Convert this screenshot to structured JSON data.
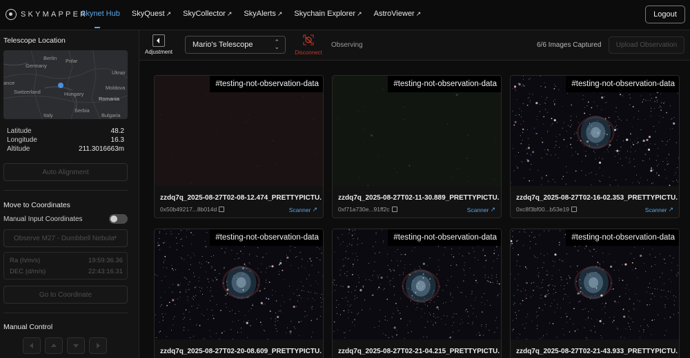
{
  "nav": {
    "logo": "SKYMAPPER",
    "links": [
      {
        "label": "Skynet Hub",
        "active": true,
        "external": false
      },
      {
        "label": "SkyQuest",
        "external": true
      },
      {
        "label": "SkyCollector",
        "external": true
      },
      {
        "label": "SkyAlerts",
        "external": true
      },
      {
        "label": "Skychain Explorer",
        "external": true
      },
      {
        "label": "AstroViewer",
        "external": true
      }
    ],
    "external_glyph": "↗",
    "logout": "Logout"
  },
  "sidebar": {
    "location_title": "Telescope Location",
    "map_labels": [
      "Berlin",
      "Germany",
      "Polar",
      "Ukrair",
      "ance",
      "Switzerland",
      "Hungary",
      "Moldova",
      "Romania",
      "Serbia",
      "Bulgaria",
      "Italy"
    ],
    "latitude_label": "Latitude",
    "latitude_value": "48.2",
    "longitude_label": "Longitude",
    "longitude_value": "16.3",
    "altitude_label": "Altitude",
    "altitude_value": "211.3016663m",
    "auto_alignment": "Auto Alignment",
    "move_title": "Move to Coordinates",
    "manual_input_label": "Manual Input Coordinates",
    "manual_input_enabled": false,
    "observe_button": "Observe M27 - Dumbbell Nebula",
    "observe_plus": "+",
    "ra_label": "Ra (h/m/s)",
    "ra_value": "19:59:36.36",
    "dec_label": "DEC (d/m/s)",
    "dec_value": "22:43:16.31",
    "goto_button": "Go to Coordinate",
    "manual_control_title": "Manual Control"
  },
  "controlbar": {
    "adjustment_label": "Adjustment",
    "telescope_select": "Mario's Telescope",
    "disconnect_label": "Disconnect",
    "status": "Observing",
    "captured": "6/6 Images Captured",
    "upload": "Upload Observation"
  },
  "colors": {
    "accent": "#5aa7e8",
    "danger": "#c0392b"
  },
  "images": [
    {
      "tag": "#testing-not-observation-data",
      "filename": "zzdq7q_2025-08-27T02-08-12.474_PRETTYPICTU...",
      "hash": "0x50b49217...8b014d",
      "scanner": "Scanner",
      "style": "dark-red",
      "nebula": false
    },
    {
      "tag": "#testing-not-observation-data",
      "filename": "zzdq7q_2025-08-27T02-11-30.889_PRETTYPICTU...",
      "hash": "0xf71a730e...91ff2c",
      "scanner": "Scanner",
      "style": "dark-green",
      "nebula": false
    },
    {
      "tag": "#testing-not-observation-data",
      "filename": "zzdq7q_2025-08-27T02-16-02.353_PRETTYPICTU...",
      "hash": "0xc8f3bf00...b53e19",
      "scanner": "Scanner",
      "style": "stars",
      "nebula": true
    },
    {
      "tag": "#testing-not-observation-data",
      "filename": "zzdq7q_2025-08-27T02-20-08.609_PRETTYPICTU...",
      "hash": "",
      "scanner": "",
      "style": "stars",
      "nebula": true
    },
    {
      "tag": "#testing-not-observation-data",
      "filename": "zzdq7q_2025-08-27T02-21-04.215_PRETTYPICTU...",
      "hash": "",
      "scanner": "",
      "style": "stars",
      "nebula": true
    },
    {
      "tag": "#testing-not-observation-data",
      "filename": "zzdq7q_2025-08-27T02-21-43.933_PRETTYPICTU...",
      "hash": "",
      "scanner": "",
      "style": "stars",
      "nebula": true
    }
  ]
}
